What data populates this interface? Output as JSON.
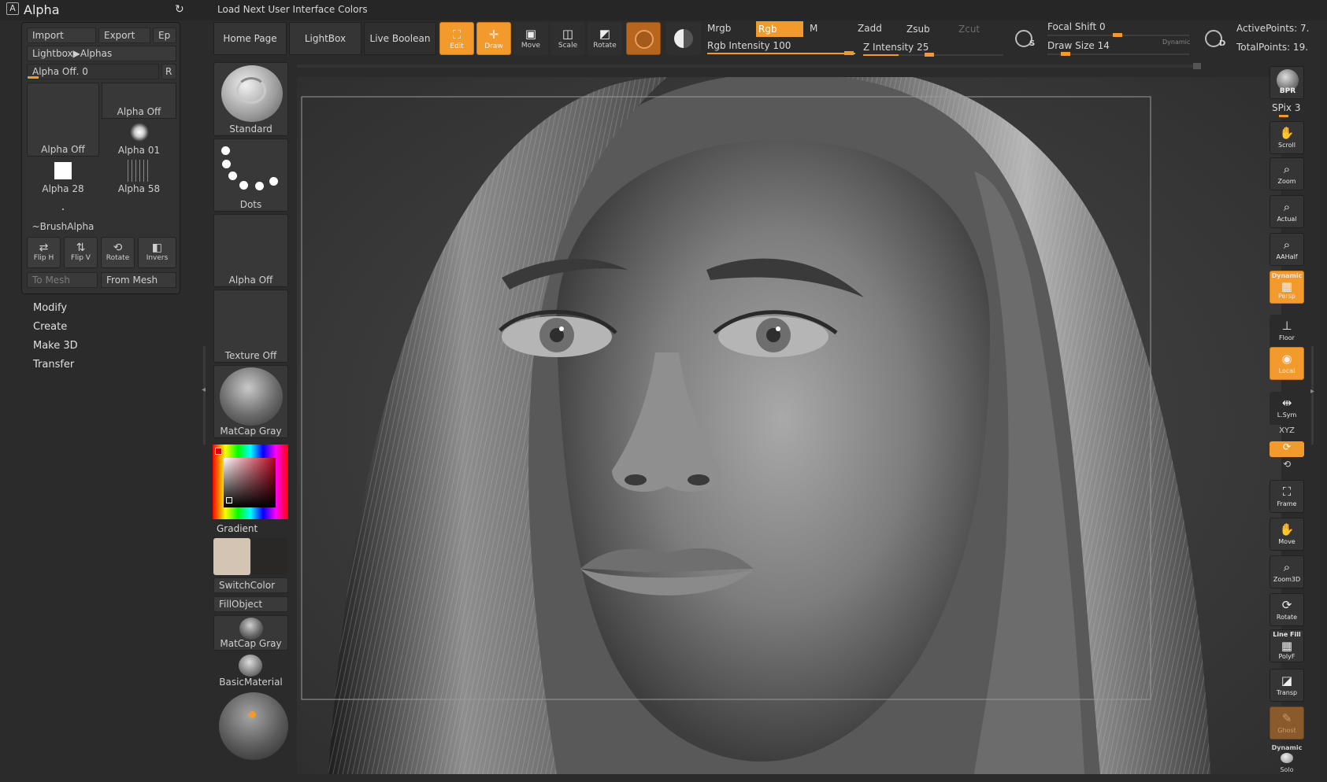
{
  "app": {
    "palette_title": "Alpha",
    "load_next_label": "Load Next User Interface Colors"
  },
  "alpha_panel": {
    "import_label": "Import",
    "export_label": "Export",
    "ep_label": "Ep",
    "lightbox_label": "Lightbox▶Alphas",
    "alpha_off_slider": "Alpha Off. 0",
    "r_label": "R",
    "thumbs": [
      {
        "label": "Alpha Off"
      },
      {
        "label": "Alpha Off"
      },
      {
        "label": "Alpha 01"
      },
      {
        "label": "Alpha 28"
      },
      {
        "label": "Alpha 58"
      },
      {
        "label": "~BrushAlpha"
      }
    ],
    "flip_h_label": "Flip H",
    "flip_v_label": "Flip V",
    "rotate_label": "Rotate",
    "invers_label": "Invers",
    "to_mesh_label": "To Mesh",
    "from_mesh_label": "From Mesh"
  },
  "submenus": [
    "Modify",
    "Create",
    "Make 3D",
    "Transfer"
  ],
  "toolbar": {
    "home_page": "Home Page",
    "lightbox": "LightBox",
    "live_boolean": "Live Boolean",
    "edit": "Edit",
    "draw": "Draw",
    "move": "Move",
    "scale": "Scale",
    "rotate": "Rotate",
    "mrgb": "Mrgb",
    "rgb": "Rgb",
    "m": "M",
    "rgb_intensity": "Rgb Intensity 100",
    "rgb_intensity_value": 100,
    "zadd": "Zadd",
    "zsub": "Zsub",
    "zcut": "Zcut",
    "z_intensity": "Z Intensity 25",
    "z_intensity_value": 25,
    "focal_shift": "Focal Shift 0",
    "draw_size": "Draw Size 14",
    "dynamic": "Dynamic",
    "active_points": "ActivePoints: 7.",
    "total_points": "TotalPoints: 19.",
    "s_icon_label": "S",
    "d_icon_label": "D"
  },
  "left_shelf": {
    "standard": "Standard",
    "dots": "Dots",
    "alpha_off": "Alpha Off",
    "texture_off": "Texture Off",
    "matcap_gray": "MatCap Gray",
    "gradient": "Gradient",
    "switch_color": "SwitchColor",
    "fill_object": "FillObject",
    "matcap_gray_2": "MatCap Gray",
    "basic_material": "BasicMaterial",
    "main_color": "#d3c4b3",
    "secondary_color": "#2a2727"
  },
  "right_shelf": {
    "bpr": "BPR",
    "spix": "SPix 3",
    "scroll": "Scroll",
    "zoom": "Zoom",
    "actual": "Actual",
    "aahalf": "AAHalf",
    "dynamic": "Dynamic",
    "persp": "Persp",
    "floor": "Floor",
    "local": "Local",
    "lsym": "L.Sym",
    "xyz": "XYZ",
    "frame": "Frame",
    "move": "Move",
    "zoom3d": "Zoom3D",
    "rotate": "Rotate",
    "line_fill": "Line Fill",
    "polyf": "PolyF",
    "transp": "Transp",
    "ghost": "Ghost",
    "dynamic2": "Dynamic",
    "solo": "Solo"
  },
  "colors": {
    "accent": "#f39a2c",
    "panel": "#323232",
    "background": "#2b2b2b"
  }
}
